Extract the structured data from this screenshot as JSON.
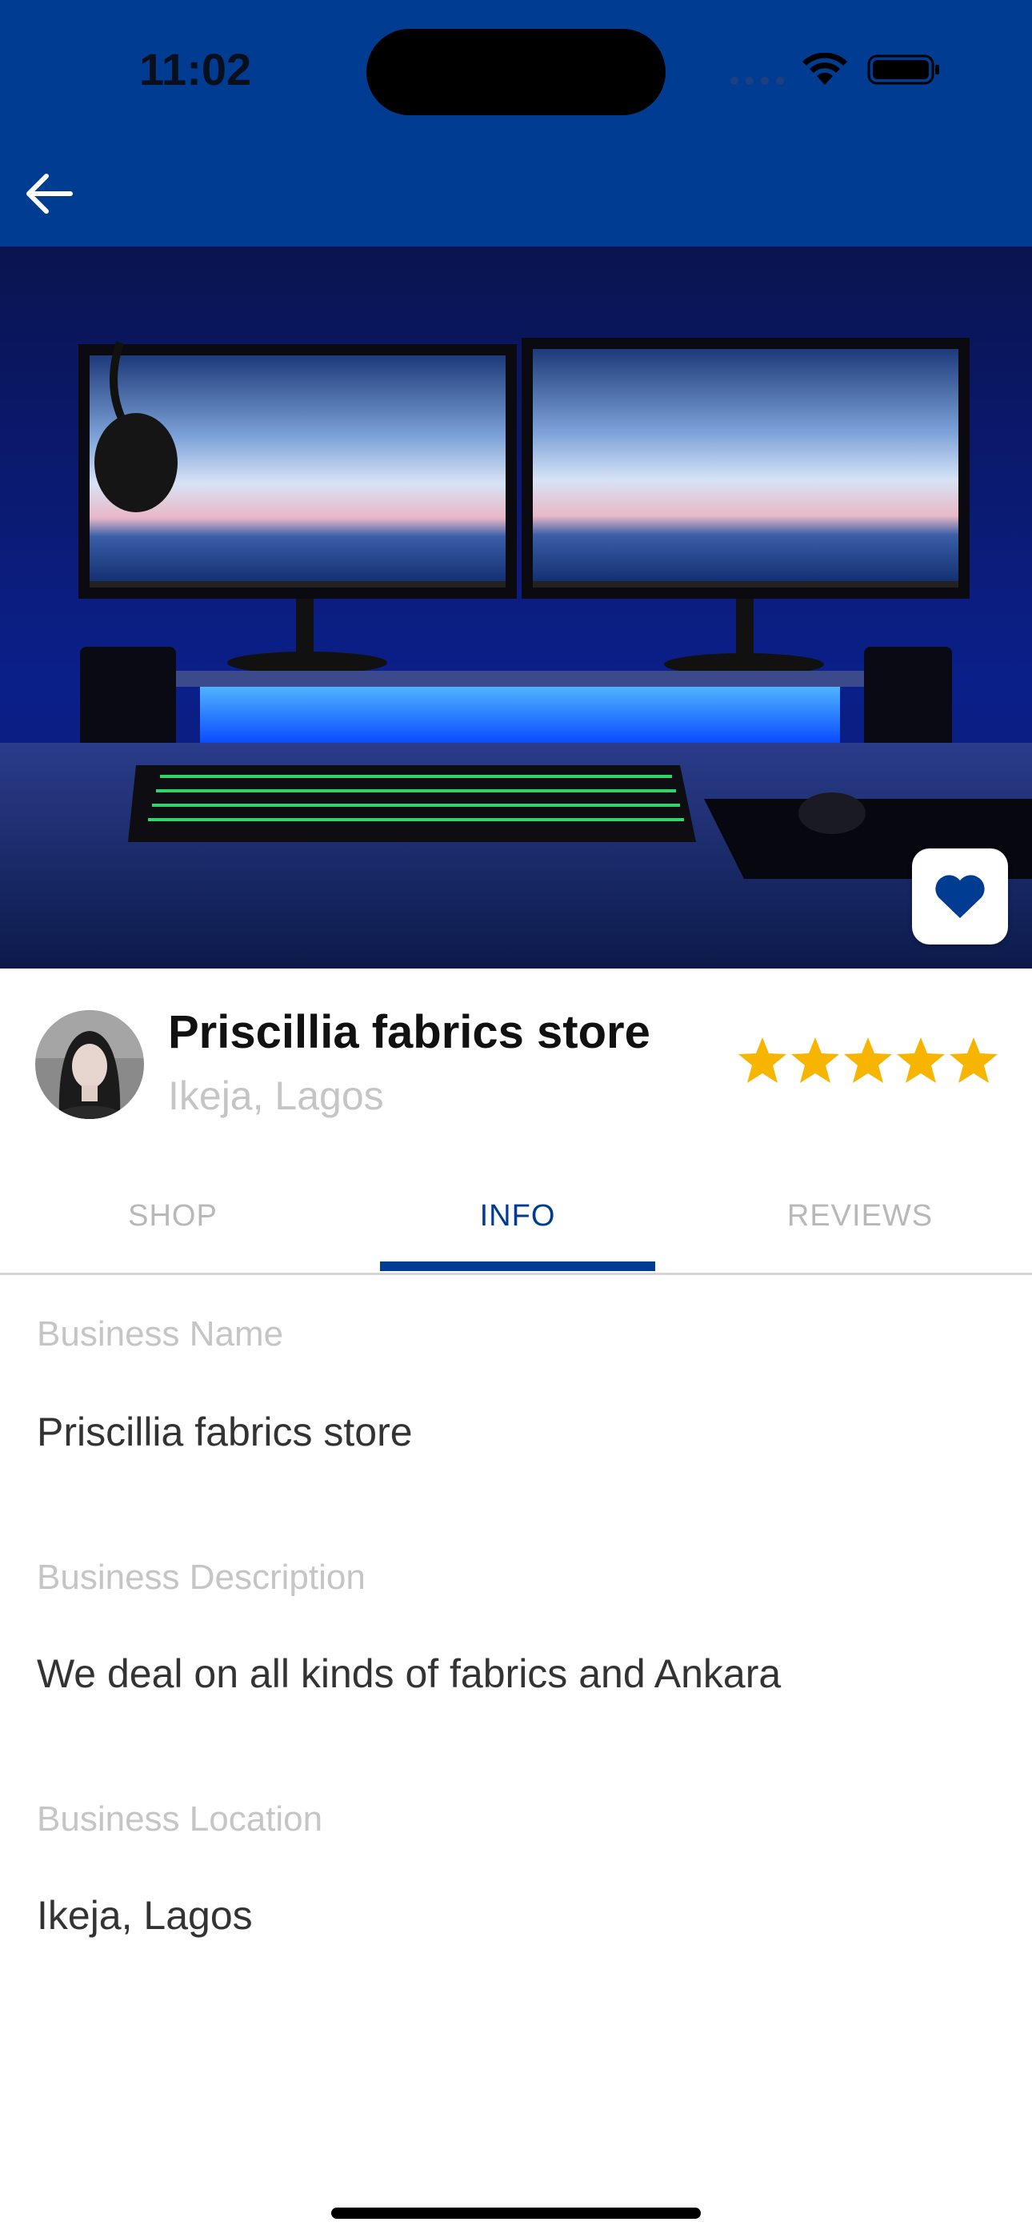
{
  "status_bar": {
    "time": "11:02"
  },
  "colors": {
    "brand": "#003c92",
    "star": "#f7b500",
    "label": "#c5c5c5"
  },
  "nav": {
    "back_icon": "arrow-left-icon"
  },
  "hero": {
    "favorite_icon": "heart-icon"
  },
  "store": {
    "name": "Priscillia fabrics store",
    "location": "Ikeja, Lagos",
    "rating": 5,
    "rating_max": 5
  },
  "tabs": [
    {
      "label": "SHOP",
      "active": false
    },
    {
      "label": "INFO",
      "active": true
    },
    {
      "label": "REVIEWS",
      "active": false
    }
  ],
  "info": {
    "business_name_label": "Business Name",
    "business_name_value": "Priscillia fabrics store",
    "business_description_label": "Business Description",
    "business_description_value": "We deal on all kinds of fabrics and Ankara",
    "business_location_label": "Business Location",
    "business_location_value": "Ikeja, Lagos"
  }
}
